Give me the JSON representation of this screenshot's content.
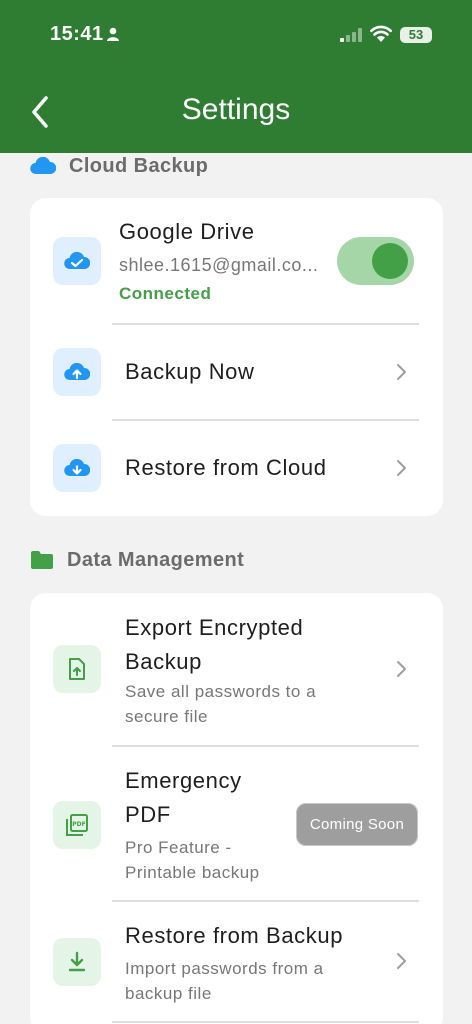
{
  "status_bar": {
    "time": "15:41",
    "battery": "53"
  },
  "header": {
    "title": "Settings"
  },
  "cloud_backup": {
    "section_title": "Cloud Backup",
    "google_drive": {
      "title": "Google Drive",
      "email": "shlee.1615@gmail.co...",
      "status": "Connected",
      "toggle_on": true
    },
    "backup_now": "Backup Now",
    "restore_cloud": "Restore from Cloud"
  },
  "data_management": {
    "section_title": "Data Management",
    "export": {
      "title_line1": "Export Encrypted",
      "title_line2": "Backup",
      "sub_line1": "Save all passwords to a",
      "sub_line2": "secure file"
    },
    "emergency": {
      "title_line1": "Emergency",
      "title_line2": "PDF",
      "sub_line1": "Pro Feature -",
      "sub_line2": "Printable backup",
      "badge": "Coming Soon"
    },
    "restore_backup": {
      "title": "Restore from Backup",
      "sub_line1": "Import passwords from a",
      "sub_line2": "backup file"
    }
  },
  "colors": {
    "header_green": "#2e7d32",
    "connected_green": "#43a047",
    "cloud_blue": "#2196f3"
  }
}
